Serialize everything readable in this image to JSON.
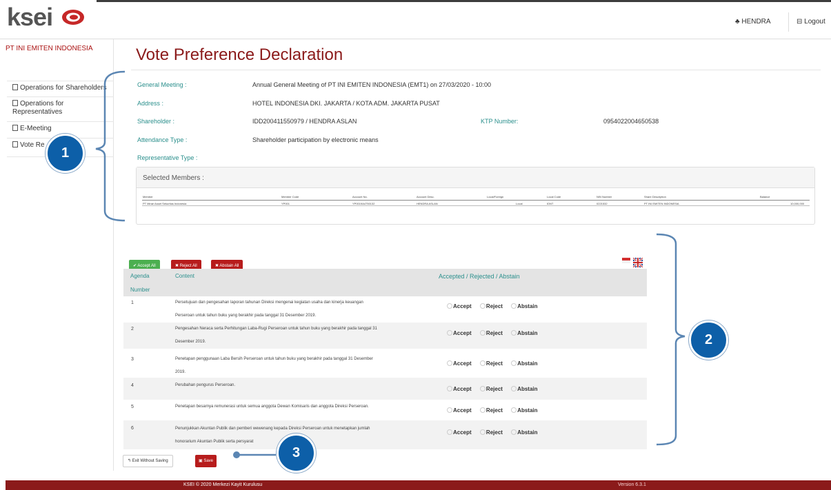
{
  "header": {
    "logo_text": "ksei",
    "user_label": "♣ HENDRA",
    "logout_label": "⊟ Logout"
  },
  "sidebar": {
    "company": "PT INI EMITEN INDONESIA",
    "items": [
      {
        "label": "Operations for Shareholders"
      },
      {
        "label": "Operations for Representatives"
      },
      {
        "label": "E-Meeting"
      },
      {
        "label": "Vote Re"
      }
    ]
  },
  "page": {
    "title": "Vote Preference Declaration"
  },
  "info": {
    "general_meeting_label": "General Meeting :",
    "general_meeting_value": "Annual General Meeting of PT INI EMITEN INDONESIA (EMT1) on 27/03/2020 - 10:00",
    "address_label": "Address :",
    "address_value": "HOTEL INDONESIA DKI. JAKARTA / KOTA ADM. JAKARTA PUSAT",
    "shareholder_label": "Shareholder :",
    "shareholder_value": "IDD200411550979 / HENDRA ASLAN",
    "ktp_label": "KTP Number:",
    "ktp_value": "0954022004650538",
    "attendance_label": "Attendance Type :",
    "attendance_value": "Shareholder participation by electronic means",
    "representative_label": "Representative Type :"
  },
  "members": {
    "heading": "Selected Members :",
    "columns": [
      "Member",
      "Member Code",
      "Account No.",
      "Account Desc.",
      "Local/Foreign",
      "Local Code",
      "NIN Number",
      "Share Description",
      "Balance"
    ],
    "row": [
      "PT Mirae Asset Sekuritas Indonesia",
      "YP001",
      "YP0019A4750132",
      "HENDRA ASLAN",
      "Local",
      "IDNT",
      "0221532",
      "PT INI EMITEN INDONESIA",
      "10,000,000"
    ]
  },
  "actions": {
    "accept_all": "✔ Accept All",
    "reject_all": "✖ Reject All",
    "abstain_all": "✖ Abstain All"
  },
  "agenda": {
    "col_number": "Agenda",
    "col_number_2": "Number",
    "col_content": "Content",
    "col_vote": "Accepted / Rejected / Abstain",
    "options": [
      "Accept",
      "Reject",
      "Abstain"
    ],
    "rows": [
      {
        "number": "1",
        "line1": "Persetujuan dan pengesahan laporan tahunan Direksi mengenai kegiatan usaha dan kinerja keuangan",
        "line2": "Perseroan untuk tahun buku yang berakhir pada tanggal 31 Desember 2019."
      },
      {
        "number": "2",
        "line1": "Pengesahan Neraca serta Perhitungan Laba-Rugi Perseroan untuk tahun buku yang berakhir pada tanggal 31",
        "line2": "Desember 2019."
      },
      {
        "number": "3",
        "line1": "Penetapan penggunaan Laba Bersih Perseroan untuk tahun buku yang berakhir pada tanggal 31 Desember",
        "line2": "2019."
      },
      {
        "number": "4",
        "line1": "Perubahan pengurus Perseroan.",
        "line2": ""
      },
      {
        "number": "5",
        "line1": "Penetapan besarnya remunerasi untuk semua anggota Dewan Komisaris dan anggota Direksi Perseroan.",
        "line2": ""
      },
      {
        "number": "6",
        "line1": "Penunjukkan Akuntan Publik dan pemberi wewenang kepada Direksi Perseroan untuk menetapkan jumlah",
        "line2": "honorarium Akuntan Publik serta persyarat"
      }
    ]
  },
  "bottom": {
    "exit_label": "↰ Exit Without Saving",
    "save_label": "▣ Save"
  },
  "footer": {
    "copyright": "KSEI © 2020 Merkezi Kayit Kurulusu",
    "version": "Version 6.3.1"
  },
  "callouts": {
    "one": "1",
    "two": "2",
    "three": "3"
  },
  "colors": {
    "brand_red": "#8b1a1a",
    "teal_label": "#2a8f8c",
    "callout_blue": "#0d5fa8",
    "bracket_blue": "#5b86b3"
  }
}
